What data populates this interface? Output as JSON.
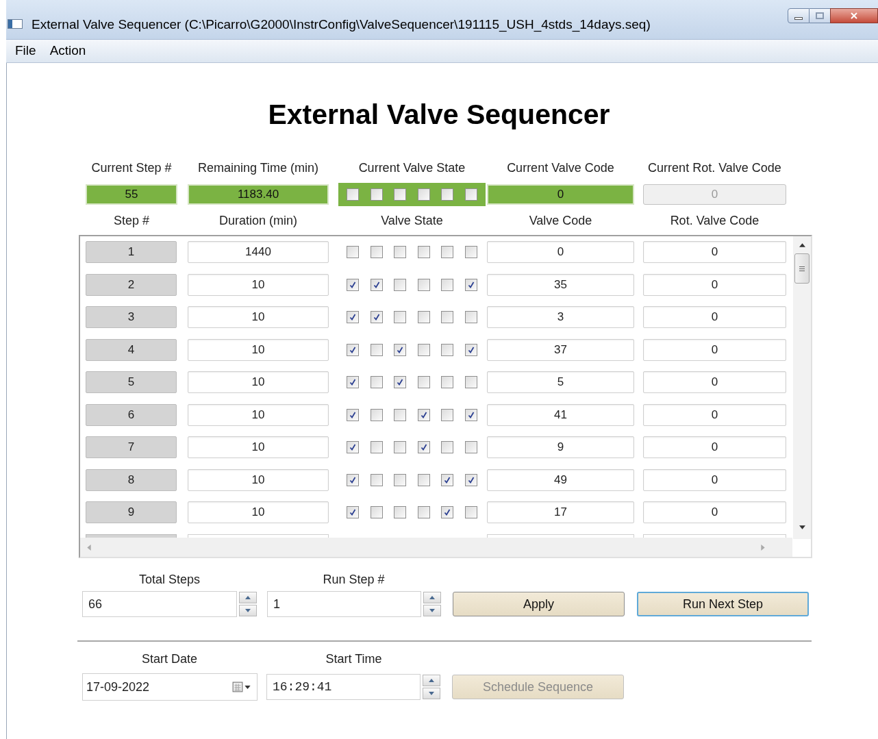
{
  "window": {
    "title": "External Valve Sequencer (C:\\Picarro\\G2000\\InstrConfig\\ValveSequencer\\191115_USH_4stds_14days.seq)"
  },
  "menu": [
    "File",
    "Action"
  ],
  "heading": "External Valve Sequencer",
  "current": {
    "labels": [
      "Current Step #",
      "Remaining Time (min)",
      "Current Valve State",
      "Current Valve Code",
      "Current Rot. Valve Code"
    ],
    "step": {
      "value": "55",
      "disabled": false
    },
    "remaining": {
      "value": "1183.40",
      "disabled": false
    },
    "valve_state": [
      false,
      false,
      false,
      false,
      false,
      false
    ],
    "valve_code": {
      "value": "0",
      "disabled": false
    },
    "rot_valve_code": {
      "value": "0",
      "disabled": true
    }
  },
  "table": {
    "columns": [
      "Step #",
      "Duration (min)",
      "Valve State",
      "Valve Code",
      "Rot. Valve Code"
    ],
    "rows": [
      {
        "step": "1",
        "duration": "1440",
        "valves": [
          false,
          false,
          false,
          false,
          false,
          false
        ],
        "code": "0",
        "rot": "0"
      },
      {
        "step": "2",
        "duration": "10",
        "valves": [
          true,
          true,
          false,
          false,
          false,
          true
        ],
        "code": "35",
        "rot": "0"
      },
      {
        "step": "3",
        "duration": "10",
        "valves": [
          true,
          true,
          false,
          false,
          false,
          false
        ],
        "code": "3",
        "rot": "0"
      },
      {
        "step": "4",
        "duration": "10",
        "valves": [
          true,
          false,
          true,
          false,
          false,
          true
        ],
        "code": "37",
        "rot": "0"
      },
      {
        "step": "5",
        "duration": "10",
        "valves": [
          true,
          false,
          true,
          false,
          false,
          false
        ],
        "code": "5",
        "rot": "0"
      },
      {
        "step": "6",
        "duration": "10",
        "valves": [
          true,
          false,
          false,
          true,
          false,
          true
        ],
        "code": "41",
        "rot": "0"
      },
      {
        "step": "7",
        "duration": "10",
        "valves": [
          true,
          false,
          false,
          true,
          false,
          false
        ],
        "code": "9",
        "rot": "0"
      },
      {
        "step": "8",
        "duration": "10",
        "valves": [
          true,
          false,
          false,
          false,
          true,
          true
        ],
        "code": "49",
        "rot": "0"
      },
      {
        "step": "9",
        "duration": "10",
        "valves": [
          true,
          false,
          false,
          false,
          true,
          false
        ],
        "code": "17",
        "rot": "0"
      }
    ]
  },
  "total_steps": {
    "label": "Total Steps",
    "value": "66"
  },
  "run_step": {
    "label": "Run Step #",
    "value": "1"
  },
  "buttons": [
    {
      "label": "Apply",
      "focused": false,
      "disabled": false
    },
    {
      "label": "Run Next Step",
      "focused": true,
      "disabled": false
    }
  ],
  "start_date": {
    "label": "Start Date",
    "value": "17-09-2022"
  },
  "start_time": {
    "label": "Start Time",
    "value": "16:29:41"
  },
  "schedule_button": {
    "label": "Schedule Sequence",
    "disabled": true
  }
}
